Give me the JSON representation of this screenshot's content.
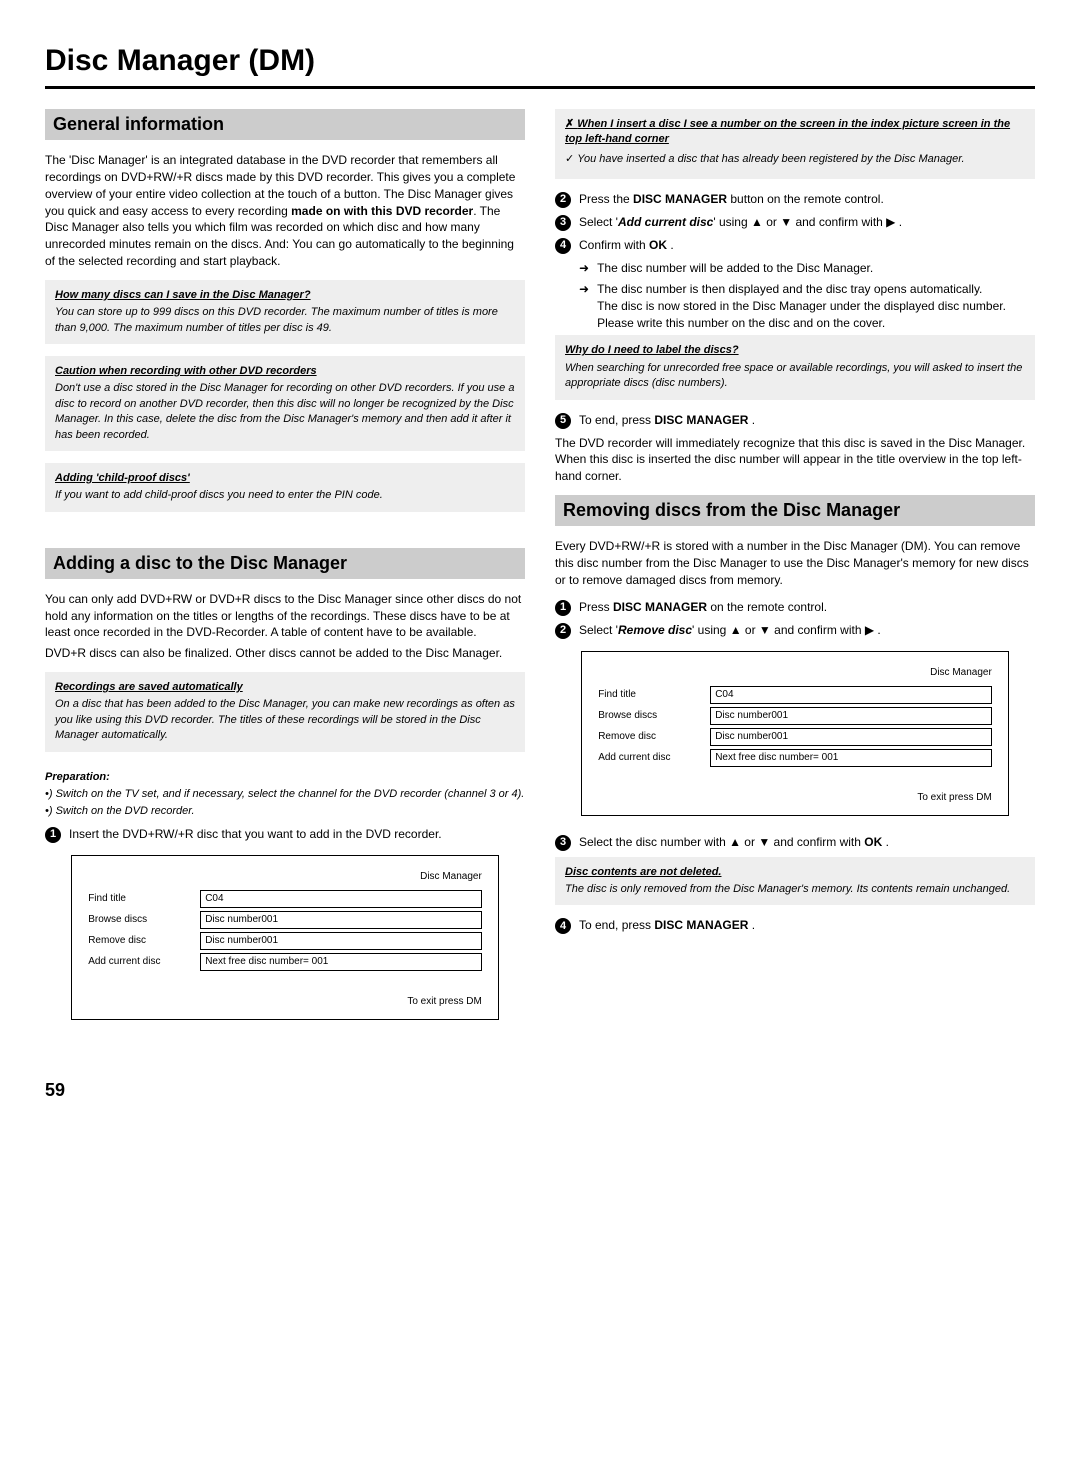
{
  "page_title": "Disc Manager (DM)",
  "page_number": "59",
  "left": {
    "sec1_header": "General information",
    "sec1_p1a": "The 'Disc Manager' is an integrated database in the DVD recorder that remembers all recordings on DVD+RW/+R discs made by this DVD recorder. This gives you a complete overview of your entire video collection at the touch of a button. The Disc Manager gives you quick and easy access to every recording ",
    "sec1_p1b": "made on with this DVD recorder",
    "sec1_p1c": ". The Disc Manager also tells you which film was recorded on which disc and how many unrecorded minutes remain on the discs. And: You can go automatically to the beginning of the selected recording and start playback.",
    "nb1_title": "How many discs can I save in the Disc Manager?",
    "nb1_body": "You can store up to 999 discs on this DVD recorder. The maximum number of titles is more than 9,000. The maximum number of titles per disc is 49.",
    "nb2_title": "Caution when recording with other DVD recorders",
    "nb2_body": "Don't use a disc stored in the Disc Manager for recording on other DVD recorders. If you use a disc to record on another DVD recorder, then this disc will no longer be recognized by the Disc Manager. In this case, delete the disc from the Disc Manager's memory and then add it after it has been recorded.",
    "nb3_title": "Adding 'child-proof discs'",
    "nb3_body": "If you want to add child-proof discs you need to enter the PIN code.",
    "sec2_header": "Adding a disc to the Disc Manager",
    "sec2_p1": "You can only add DVD+RW or DVD+R discs to the Disc Manager since other discs do not hold any information on the titles or lengths of the recordings. These discs have to be at least once recorded in the DVD-Recorder. A table of content have to be available.",
    "sec2_p2": "DVD+R discs can also be finalized. Other discs cannot be added to the Disc Manager.",
    "nb4_title": "Recordings are saved automatically",
    "nb4_body": "On a disc that has been added to the Disc Manager, you can make new recordings as often as you like using this DVD recorder. The titles of these recordings will be stored in the Disc Manager automatically.",
    "prep_title": "Preparation:",
    "prep1": "•) Switch on the TV set, and if necessary, select the channel for the DVD recorder (channel 3 or 4).",
    "prep2": "•) Switch on the DVD recorder.",
    "step1": "Insert the DVD+RW/+R disc that you want to add in the DVD recorder."
  },
  "right": {
    "nbA_problem": "When I insert a disc I see a number on the screen in the index picture screen in the top left-hand corner",
    "nbA_solution": "You have inserted a disc that has already been registered by the Disc Manager.",
    "step2a": "Press the ",
    "step2b": "DISC MANAGER",
    "step2c": " button on the remote control.",
    "step3a": "Select '",
    "step3b": "Add current disc",
    "step3c": "' using ",
    "step3d": " and confirm with ",
    "step4a": "Confirm with ",
    "step4b": "OK",
    "step4c": " .",
    "sub1": "The disc number will be added to the Disc Manager.",
    "sub2": "The disc number is then displayed and the disc tray opens automatically.",
    "sub2b": "The disc is now stored in the Disc Manager under the displayed disc number.",
    "sub2c": "Please write this number on the disc and on the cover.",
    "nbB_title": "Why do I need to label the discs?",
    "nbB_body": "When searching for unrecorded free space or available recordings, you will asked to insert the appropriate discs (disc numbers).",
    "step5a": "To end, press ",
    "step5b": "DISC MANAGER",
    "step5c": " .",
    "after5": "The DVD recorder will immediately recognize that this disc is saved in the Disc Manager. When this disc is inserted the disc number will appear in the title overview in the top left-hand corner.",
    "sec3_header": "Removing discs from the Disc Manager",
    "sec3_p1": "Every DVD+RW/+R is stored with a number in the Disc Manager (DM). You can remove this disc number from the Disc Manager to use the Disc Manager's memory for new discs or to remove damaged discs from memory.",
    "r_step1a": "Press ",
    "r_step1b": "DISC MANAGER",
    "r_step1c": " on the remote control.",
    "r_step2a": "Select '",
    "r_step2b": "Remove disc",
    "r_step2c": "' using ",
    "r_step2d": " and confirm with ",
    "r_step3a": "Select the disc number with ",
    "r_step3b": " and confirm with ",
    "r_step3c": "OK",
    "r_step3d": " .",
    "nbC_title": "Disc contents are not deleted.",
    "nbC_body": "The disc is only removed from the Disc Manager's memory. Its contents remain unchanged.",
    "r_step4a": "To end, press ",
    "r_step4b": "DISC MANAGER",
    "r_step4c": " ."
  },
  "osd": {
    "title": "Disc Manager",
    "rows": [
      {
        "label": "Find title",
        "value": "C04"
      },
      {
        "label": "Browse discs",
        "value": "Disc number001"
      },
      {
        "label": "Remove disc",
        "value": "Disc number001"
      },
      {
        "label": "Add current disc",
        "value": "Next free disc number= 001"
      }
    ],
    "footer": "To exit press DM"
  },
  "arrows": {
    "up": "▲",
    "down": "▼",
    "right": "▶",
    "or": " or "
  }
}
